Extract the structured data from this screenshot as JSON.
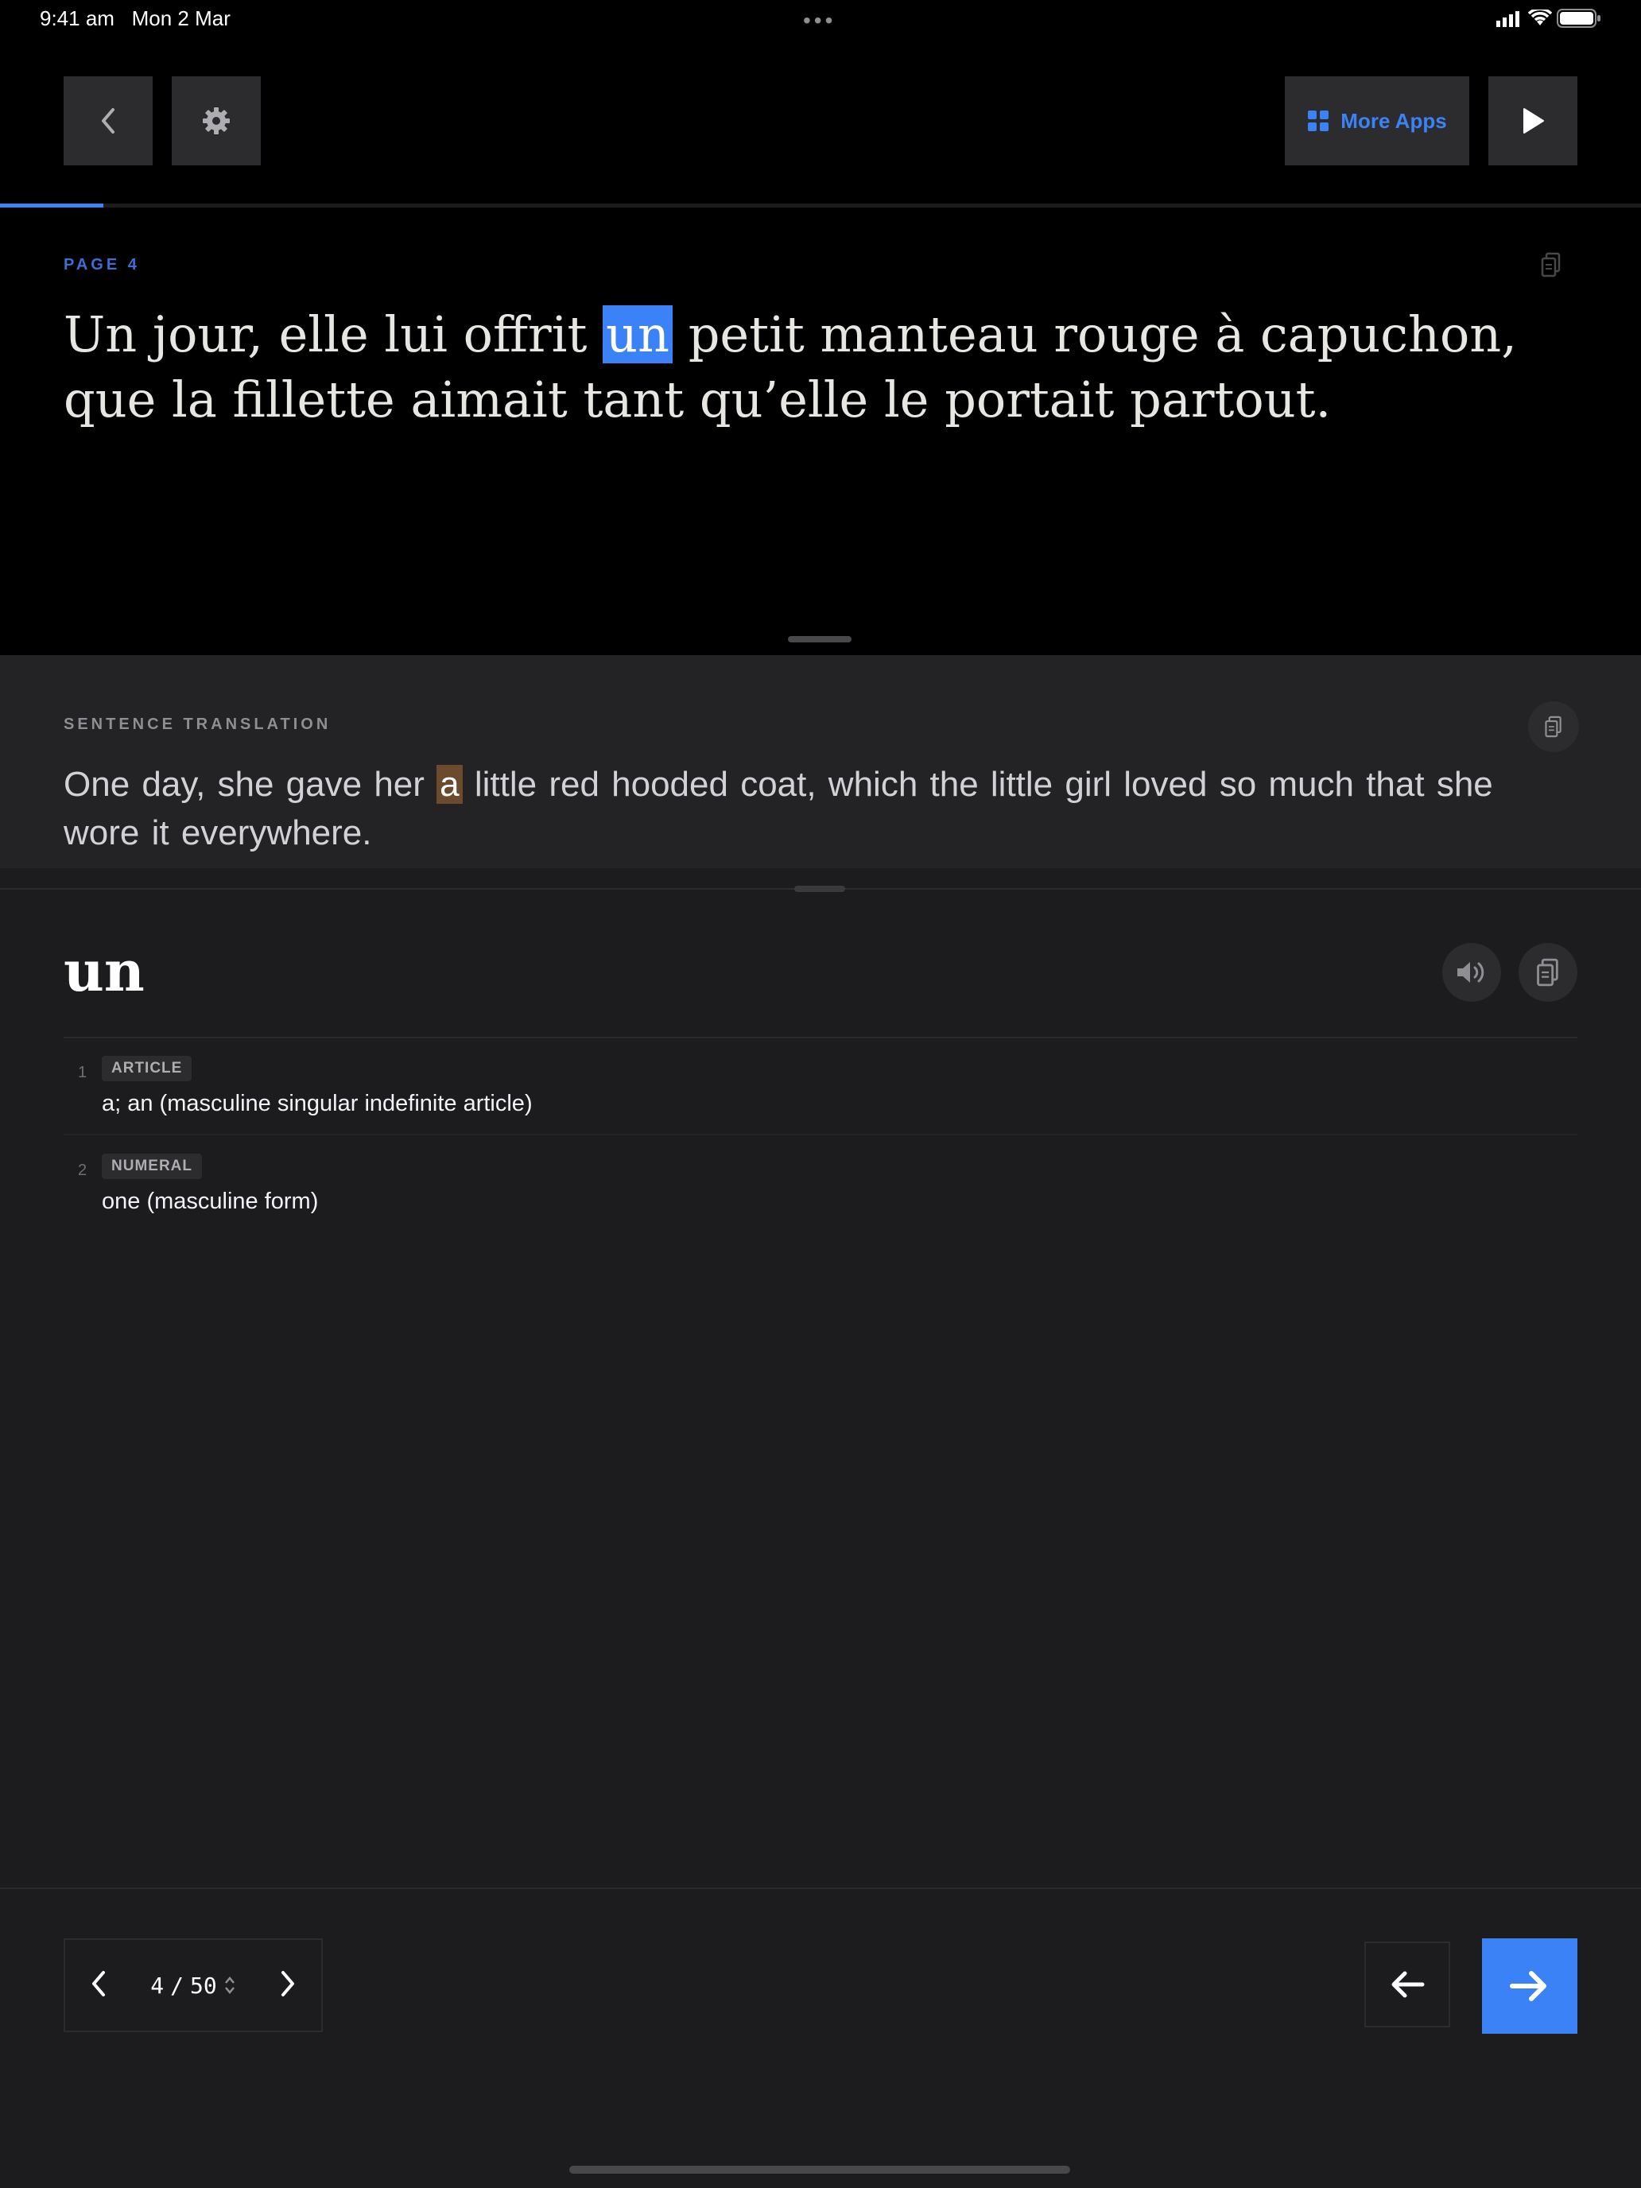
{
  "status_bar": {
    "time": "9:41 am",
    "date": "Mon 2 Mar",
    "multitasking_indicator": "•••"
  },
  "toolbar": {
    "back_icon": "chevron-left-icon",
    "settings_icon": "gear-icon",
    "more_apps_label": "More Apps",
    "more_apps_icon": "grid-icon",
    "play_icon": "play-icon"
  },
  "reading_progress": {
    "fraction": 0.063
  },
  "reader": {
    "page_label": "PAGE 4",
    "sentence_before": "Un jour, elle lui offrit ",
    "selected_word": "un",
    "sentence_after": " petit manteau rouge à capuchon, que la fillette aimait tant qu’elle le portait partout."
  },
  "translation": {
    "label": "SENTENCE TRANSLATION",
    "text_before": "One day, she gave her ",
    "highlighted_word": "a",
    "text_after": " little red hooded coat, which the little girl loved so much that she wore it everywhere."
  },
  "definition": {
    "headword": "un",
    "senses": [
      {
        "number": "1",
        "pos": "ARTICLE",
        "gloss": "a; an (masculine singular indefinite article)"
      },
      {
        "number": "2",
        "pos": "NUMERAL",
        "gloss": "one (masculine form)"
      }
    ]
  },
  "pager": {
    "current": "4",
    "separator": "/",
    "total": "50"
  },
  "colors": {
    "accent": "#3b82f6",
    "translation_highlight": "#6b4a2d",
    "background": "#1c1c1e"
  }
}
